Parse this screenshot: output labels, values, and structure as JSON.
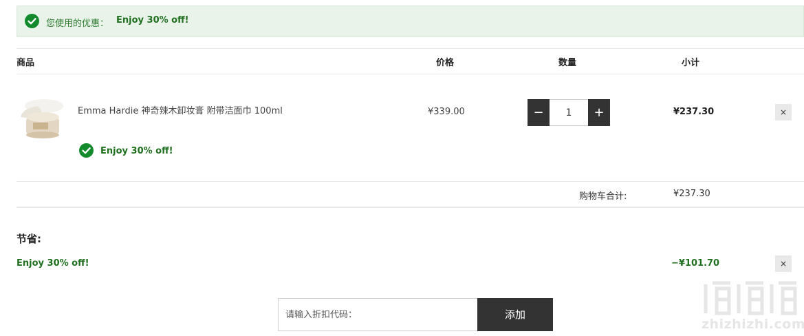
{
  "banner": {
    "label": "您使用的优惠：",
    "code": "Enjoy 30% off!"
  },
  "table_headers": {
    "product": "商品",
    "price": "价格",
    "quantity": "数量",
    "subtotal": "小计"
  },
  "item": {
    "name": "Emma Hardie 神奇辣木卸妆膏 附带洁面巾 100ml",
    "discount": "Enjoy 30% off!",
    "price": "¥339.00",
    "quantity": "1",
    "subtotal": "¥237.30",
    "minus": "−",
    "plus": "+",
    "remove": "×"
  },
  "cart_total": {
    "label": "购物车合计:",
    "value": "¥237.30"
  },
  "savings": {
    "title": "节省:",
    "name": "Enjoy 30% off!",
    "amount": "−¥101.70",
    "remove": "×"
  },
  "coupon": {
    "placeholder": "请输入折扣代码：",
    "button": "添加"
  },
  "watermark": {
    "text": "zhizhizhi.com"
  },
  "colors": {
    "success_green": "#138a2c",
    "banner_bg": "#e9f3ea",
    "dark_button": "#333333"
  }
}
